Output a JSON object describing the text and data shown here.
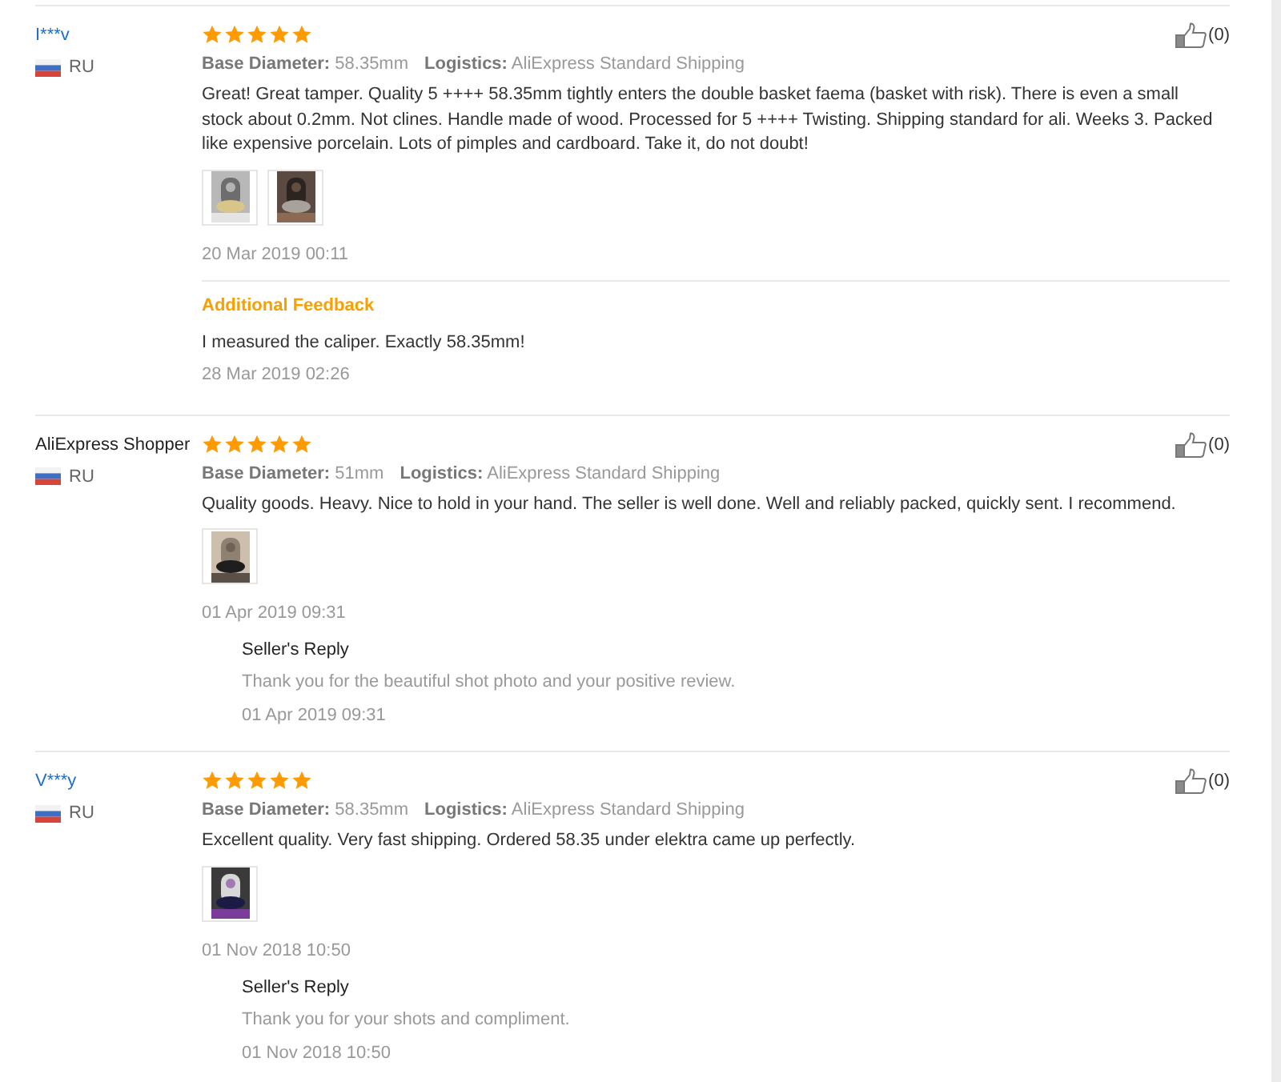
{
  "reviews": [
    {
      "user": {
        "name": "I***v",
        "kind": "masked"
      },
      "country": "RU",
      "stars": 5,
      "attributes": [
        {
          "label": "Base Diameter:",
          "value": "58.35mm"
        },
        {
          "label": "Logistics:",
          "value": "AliExpress Standard Shipping"
        }
      ],
      "text": "Great! Great tamper. Quality 5 ++++ 58.35mm tightly enters the double basket faema (basket with risk). There is even a small stock about 0.2mm. Not clines. Handle made of wood. Processed for 5 ++++ Twisting. Shipping standard for ali. Weeks 3. Packed like expensive porcelain. Lots of pimples and cardboard. Take it, do not doubt!",
      "photos": [
        {
          "kind": "picture"
        },
        {
          "kind": "picture"
        }
      ],
      "date": "20 Mar 2019 00:11",
      "helpful": "(0)",
      "followup": {
        "kind": "additional_feedback",
        "title": "Additional Feedback",
        "text": "I measured the caliper. Exactly 58.35mm!",
        "date": "28 Mar 2019 02:26"
      }
    },
    {
      "user": {
        "name": "AliExpress Shopper",
        "kind": "plain"
      },
      "country": "RU",
      "stars": 5,
      "attributes": [
        {
          "label": "Base Diameter:",
          "value": "51mm"
        },
        {
          "label": "Logistics:",
          "value": "AliExpress Standard Shipping"
        }
      ],
      "text": "Quality goods. Heavy. Nice to hold in your hand. The seller is well done. Well and reliably packed, quickly sent. I recommend.",
      "photos": [
        {
          "kind": "picture"
        }
      ],
      "date": "01 Apr 2019 09:31",
      "helpful": "(0)",
      "followup": {
        "kind": "seller_reply",
        "title": "Seller's Reply",
        "text": "Thank you for the beautiful shot photo and your positive review.",
        "date": "01 Apr 2019 09:31"
      }
    },
    {
      "user": {
        "name": "V***y",
        "kind": "masked"
      },
      "country": "RU",
      "stars": 5,
      "attributes": [
        {
          "label": "Base Diameter:",
          "value": "58.35mm"
        },
        {
          "label": "Logistics:",
          "value": "AliExpress Standard Shipping"
        }
      ],
      "text": "Excellent quality. Very fast shipping. Ordered 58.35 under elektra came up perfectly.",
      "photos": [
        {
          "kind": "picture"
        }
      ],
      "date": "01 Nov 2018 10:50",
      "helpful": "(0)",
      "followup": {
        "kind": "seller_reply",
        "title": "Seller's Reply",
        "text": "Thank you for your shots and compliment.",
        "date": "01 Nov 2018 10:50"
      }
    }
  ]
}
